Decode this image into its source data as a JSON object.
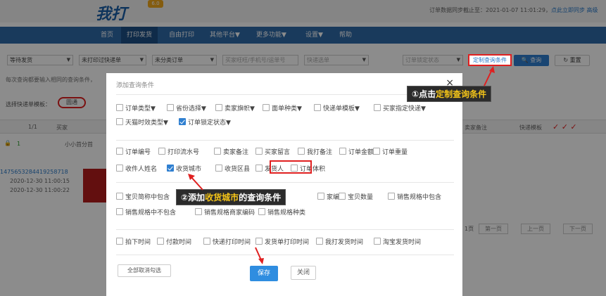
{
  "app": {
    "logo": "我打",
    "version_badge": "6.0",
    "sync_text": "订单数据同步截止至：2021-01-07 11:01:29，",
    "sync_link": "点此立即同步 高级"
  },
  "nav": {
    "items": [
      "首页",
      "打印发货",
      "自由打印",
      "其他平台▼",
      "更多功能▼",
      "设置▼",
      "帮助"
    ],
    "active": "打印发货"
  },
  "filters": {
    "selects": [
      "等待发货",
      "未打印过快递单",
      "未分类订单",
      "买家旺旺/手机号/运单号",
      "快递选单",
      "订单锁定状态"
    ],
    "custom_button": "定制查询条件",
    "query_button": "查询",
    "reset_button": "重置"
  },
  "tip_line": "每次查询都要输入相同的查询条件，",
  "template_line": {
    "label": "选择快递单模板：",
    "chip": "圆通"
  },
  "table": {
    "page_count": "1/1",
    "buyer_header": "买家",
    "seller_note_header": "卖家备注",
    "template_header": "快递模板"
  },
  "shop_row": {
    "count": "1",
    "shop_name": "小小首分首"
  },
  "order": {
    "id": "1475653284419258718",
    "time1": "2020-12-30 11:00:15",
    "time2": "2020-12-30 11:00:22"
  },
  "pager": {
    "page_label": "1页",
    "first": "第一页",
    "prev": "上一页",
    "next": "下一页"
  },
  "modal": {
    "title": "添加查询条件",
    "close": "×",
    "group1": [
      {
        "label": "订单类型▼",
        "checked": false
      },
      {
        "label": "省份选择▼",
        "checked": false
      },
      {
        "label": "卖家旗帜▼",
        "checked": false
      },
      {
        "label": "面单种类▼",
        "checked": false
      },
      {
        "label": "快递单模板▼",
        "checked": false
      },
      {
        "label": "买家指定快递▼",
        "checked": false
      },
      {
        "label": "天猫时效类型▼",
        "checked": false
      },
      {
        "label": "订单锁定状态▼",
        "checked": true
      }
    ],
    "group2": [
      {
        "label": "订单编号",
        "checked": false
      },
      {
        "label": "打印流水号",
        "checked": false
      },
      {
        "label": "卖家备注",
        "checked": false
      },
      {
        "label": "买家留言",
        "checked": false
      },
      {
        "label": "我打备注",
        "checked": false
      },
      {
        "label": "订单金额",
        "checked": false
      },
      {
        "label": "订单重量",
        "checked": false
      },
      {
        "label": "收件人姓名",
        "checked": false
      },
      {
        "label": "收货城市",
        "checked": true
      },
      {
        "label": "收货区县",
        "checked": false
      },
      {
        "label": "发货人",
        "checked": false
      },
      {
        "label": "订单体积",
        "checked": false
      }
    ],
    "group3": [
      {
        "label": "宝贝简称中包含",
        "checked": false
      },
      {
        "label": "家编码",
        "checked": false
      },
      {
        "label": "宝贝数量",
        "checked": false
      },
      {
        "label": "销售规格中包含",
        "checked": false
      },
      {
        "label": "销售规格中不包含",
        "checked": false
      },
      {
        "label": "销售规格商家编码",
        "checked": false
      },
      {
        "label": "销售规格种类",
        "checked": false
      }
    ],
    "group4": [
      {
        "label": "拍下时间",
        "checked": false
      },
      {
        "label": "付款时间",
        "checked": false
      },
      {
        "label": "快递打印时间",
        "checked": false
      },
      {
        "label": "发货单打印时间",
        "checked": false
      },
      {
        "label": "我打发货时间",
        "checked": false
      },
      {
        "label": "淘宝发货时间",
        "checked": false
      }
    ],
    "uncheck_all": "全部取消勾选",
    "save": "保存",
    "close_button": "关闭"
  },
  "callouts": {
    "c1_prefix": "①点击",
    "c1_highlight": "定制查询条件",
    "c2_prefix": "②添加",
    "c2_highlight": "收货城市",
    "c2_suffix": "的查询条件"
  },
  "colors": {
    "accent_blue": "#2f7fd0",
    "nav_blue": "#2e6aa8",
    "highlight_red": "#e02020",
    "callout_yellow": "#f5c518"
  }
}
